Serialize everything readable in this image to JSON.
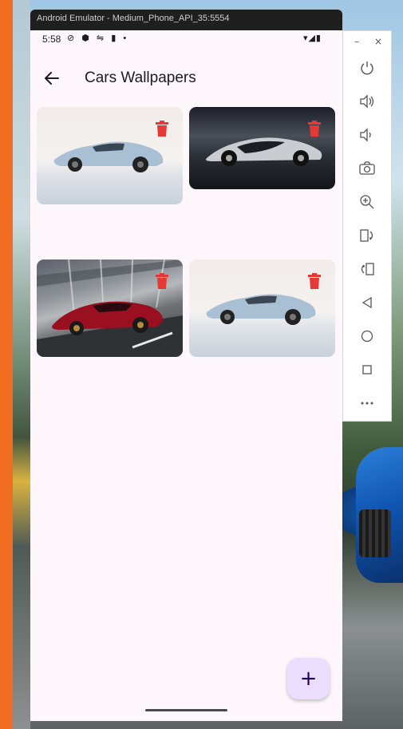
{
  "emulator": {
    "title": "Android Emulator - Medium_Phone_API_35:5554",
    "minimize_label": "–",
    "close_label": "×"
  },
  "status_bar": {
    "time": "5:58",
    "left_icons": "⊘ ⬢ ⇋ ▮ •",
    "right_icons": "▾◢▮"
  },
  "app_bar": {
    "title": "Cars Wallpapers",
    "back_icon": "arrow-back-icon"
  },
  "wallpapers": [
    {
      "image": "silver-hypercar-white-studio",
      "delete_icon": "trash-icon"
    },
    {
      "image": "silver-supercar-dark-background",
      "delete_icon": "trash-icon"
    },
    {
      "image": "red-sports-car-on-road",
      "delete_icon": "trash-icon"
    },
    {
      "image": "silver-hypercar-white-studio",
      "delete_icon": "trash-icon"
    }
  ],
  "fab": {
    "label": "+"
  },
  "toolbar": {
    "tools": [
      "power-icon",
      "volume-up-icon",
      "volume-down-icon",
      "camera-icon",
      "zoom-in-icon",
      "rotate-left-icon",
      "rotate-right-icon",
      "back-icon",
      "home-icon",
      "overview-icon",
      "more-icon"
    ]
  },
  "colors": {
    "accent": "#f26d21",
    "delete": "#e53935",
    "fab_bg": "#eaddff",
    "app_bg": "#fdf7fc"
  }
}
